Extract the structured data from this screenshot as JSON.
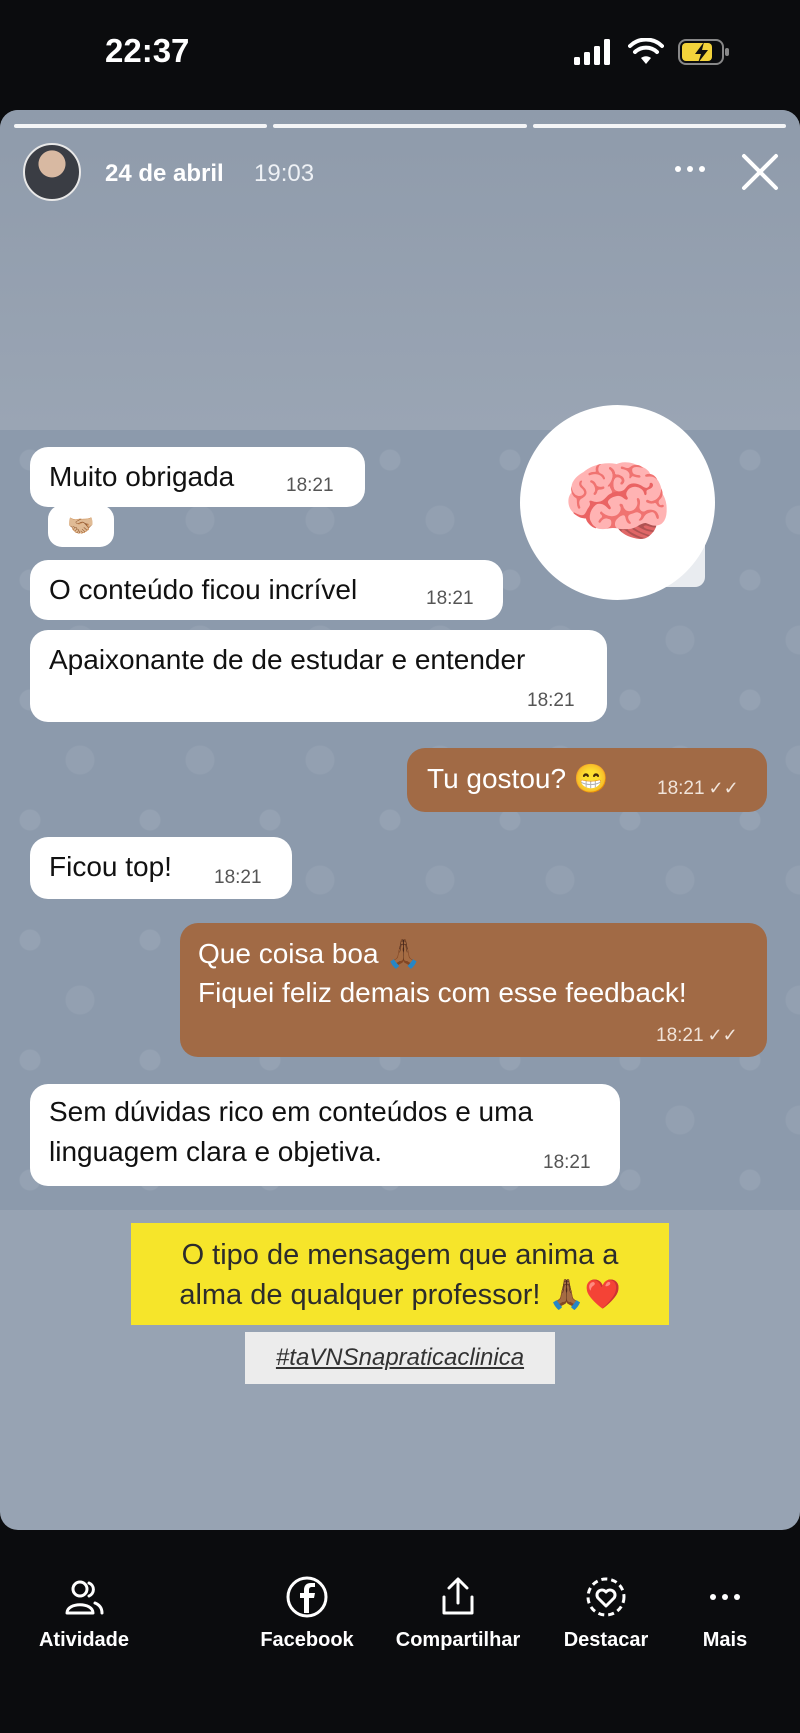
{
  "status_bar": {
    "time": "22:37"
  },
  "story_header": {
    "date": "24 de abril",
    "time": "19:03"
  },
  "messages": [
    {
      "text": "Muito obrigada",
      "time": "18:21"
    },
    {
      "text": "O conteúdo ficou incrível",
      "time": "18:21"
    },
    {
      "text": "Apaixonante de de estudar e entender",
      "time": "18:21"
    },
    {
      "text": "Tu gostou? 😁",
      "time": "18:21"
    },
    {
      "text": "Ficou top!",
      "time": "18:21"
    },
    {
      "line1": "Que coisa boa 🙏🏾",
      "line2": "Fiquei feliz demais com esse feedback!",
      "time": "18:21"
    },
    {
      "line1": "Sem dúvidas rico em conteúdos e uma",
      "line2": "linguagem clara e objetiva.",
      "time": "18:21"
    }
  ],
  "reaction_emoji": "🤝🏼",
  "sticker_emoji": "🧠",
  "caption": {
    "line1": "O tipo de mensagem que anima a",
    "line2": "alma de qualquer professor! 🙏🏾❤️"
  },
  "hashtag": "#taVNSnapraticaclinica",
  "bottom_bar": {
    "activity": "Atividade",
    "facebook": "Facebook",
    "share": "Compartilhar",
    "highlight": "Destacar",
    "more": "Mais"
  },
  "colors": {
    "outgoing_bubble": "#a16a45",
    "caption_bg": "#f6e52a",
    "story_bg": "#97a3b3"
  }
}
